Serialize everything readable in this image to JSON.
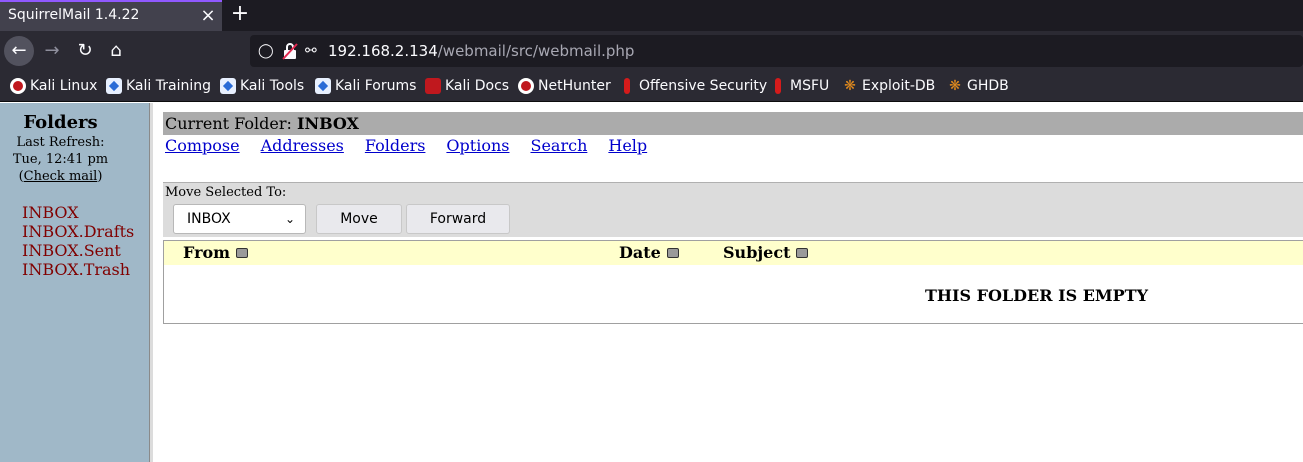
{
  "browser": {
    "tab_title": "SquirrelMail 1.4.22",
    "tab_close_icon": "×",
    "new_tab_icon": "+",
    "url_host": "192.168.2.134",
    "url_path": "/webmail/src/webmail.php",
    "accent_color": "#9059ff",
    "bookmarks": [
      {
        "label": "Kali Linux",
        "icon": "kali-icon"
      },
      {
        "label": "Kali Training",
        "icon": "kali-training-icon"
      },
      {
        "label": "Kali Tools",
        "icon": "kali-tools-icon"
      },
      {
        "label": "Kali Forums",
        "icon": "kali-forums-icon"
      },
      {
        "label": "Kali Docs",
        "icon": "kali-docs-icon"
      },
      {
        "label": "NetHunter",
        "icon": "nethunter-icon"
      },
      {
        "label": "Offensive Security",
        "icon": "offsec-icon"
      },
      {
        "label": "MSFU",
        "icon": "msfu-icon"
      },
      {
        "label": "Exploit-DB",
        "icon": "exploitdb-icon"
      },
      {
        "label": "GHDB",
        "icon": "ghdb-icon"
      }
    ]
  },
  "sidebar": {
    "title": "Folders",
    "last_refresh_label": "Last  Refresh:",
    "last_refresh_time": "Tue,  12:41  pm",
    "check_mail_open": "(",
    "check_mail_label": "Check mail",
    "check_mail_close": ")",
    "folders": [
      "INBOX",
      "INBOX.Drafts",
      "INBOX.Sent",
      "INBOX.Trash"
    ],
    "background_color": "#a0b8c8",
    "folder_link_color": "#800000"
  },
  "main": {
    "current_folder_label": "Current Folder:",
    "current_folder_name": "INBOX",
    "menu": [
      "Compose",
      "Addresses",
      "Folders",
      "Options",
      "Search",
      "Help"
    ],
    "move_selected_label": "Move Selected To:",
    "move_target_value": "INBOX",
    "move_button": "Move",
    "forward_button": "Forward",
    "columns": {
      "from": "From",
      "date": "Date",
      "subject": "Subject"
    },
    "empty_message": "THIS FOLDER IS EMPTY",
    "header_row_color": "#ffffcc"
  }
}
